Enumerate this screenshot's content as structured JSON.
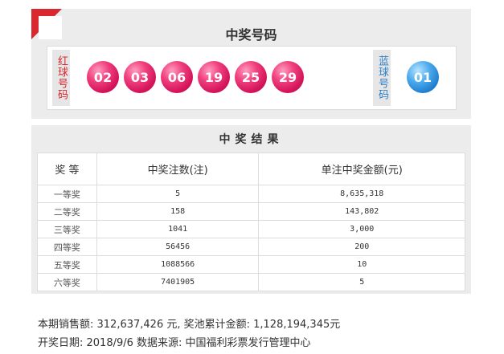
{
  "winning_numbers": {
    "title": "中奖号码",
    "red_label": "红球号码",
    "blue_label": "蓝球号码",
    "red_balls": [
      "02",
      "03",
      "06",
      "19",
      "25",
      "29"
    ],
    "blue_balls": [
      "01"
    ],
    "colors": {
      "red_ball": "#e63575",
      "blue_ball": "#2f86d6",
      "ribbon": "#d9282f"
    }
  },
  "results": {
    "title": "中奖结果",
    "headers": [
      "奖 等",
      "中奖注数(注)",
      "单注中奖金额(元)"
    ],
    "rows": [
      {
        "level": "一等奖",
        "count": "5",
        "amount": "8,635,318"
      },
      {
        "level": "二等奖",
        "count": "158",
        "amount": "143,802"
      },
      {
        "level": "三等奖",
        "count": "1041",
        "amount": "3,000"
      },
      {
        "level": "四等奖",
        "count": "56456",
        "amount": "200"
      },
      {
        "level": "五等奖",
        "count": "1088566",
        "amount": "10"
      },
      {
        "level": "六等奖",
        "count": "7401905",
        "amount": "5"
      }
    ]
  },
  "footer": {
    "line1": "本期销售额: 312,637,426 元, 奖池累计金额: 1,128,194,345元",
    "line2": "开奖日期: 2018/9/6 数据来源: 中国福利彩票发行管理中心"
  }
}
